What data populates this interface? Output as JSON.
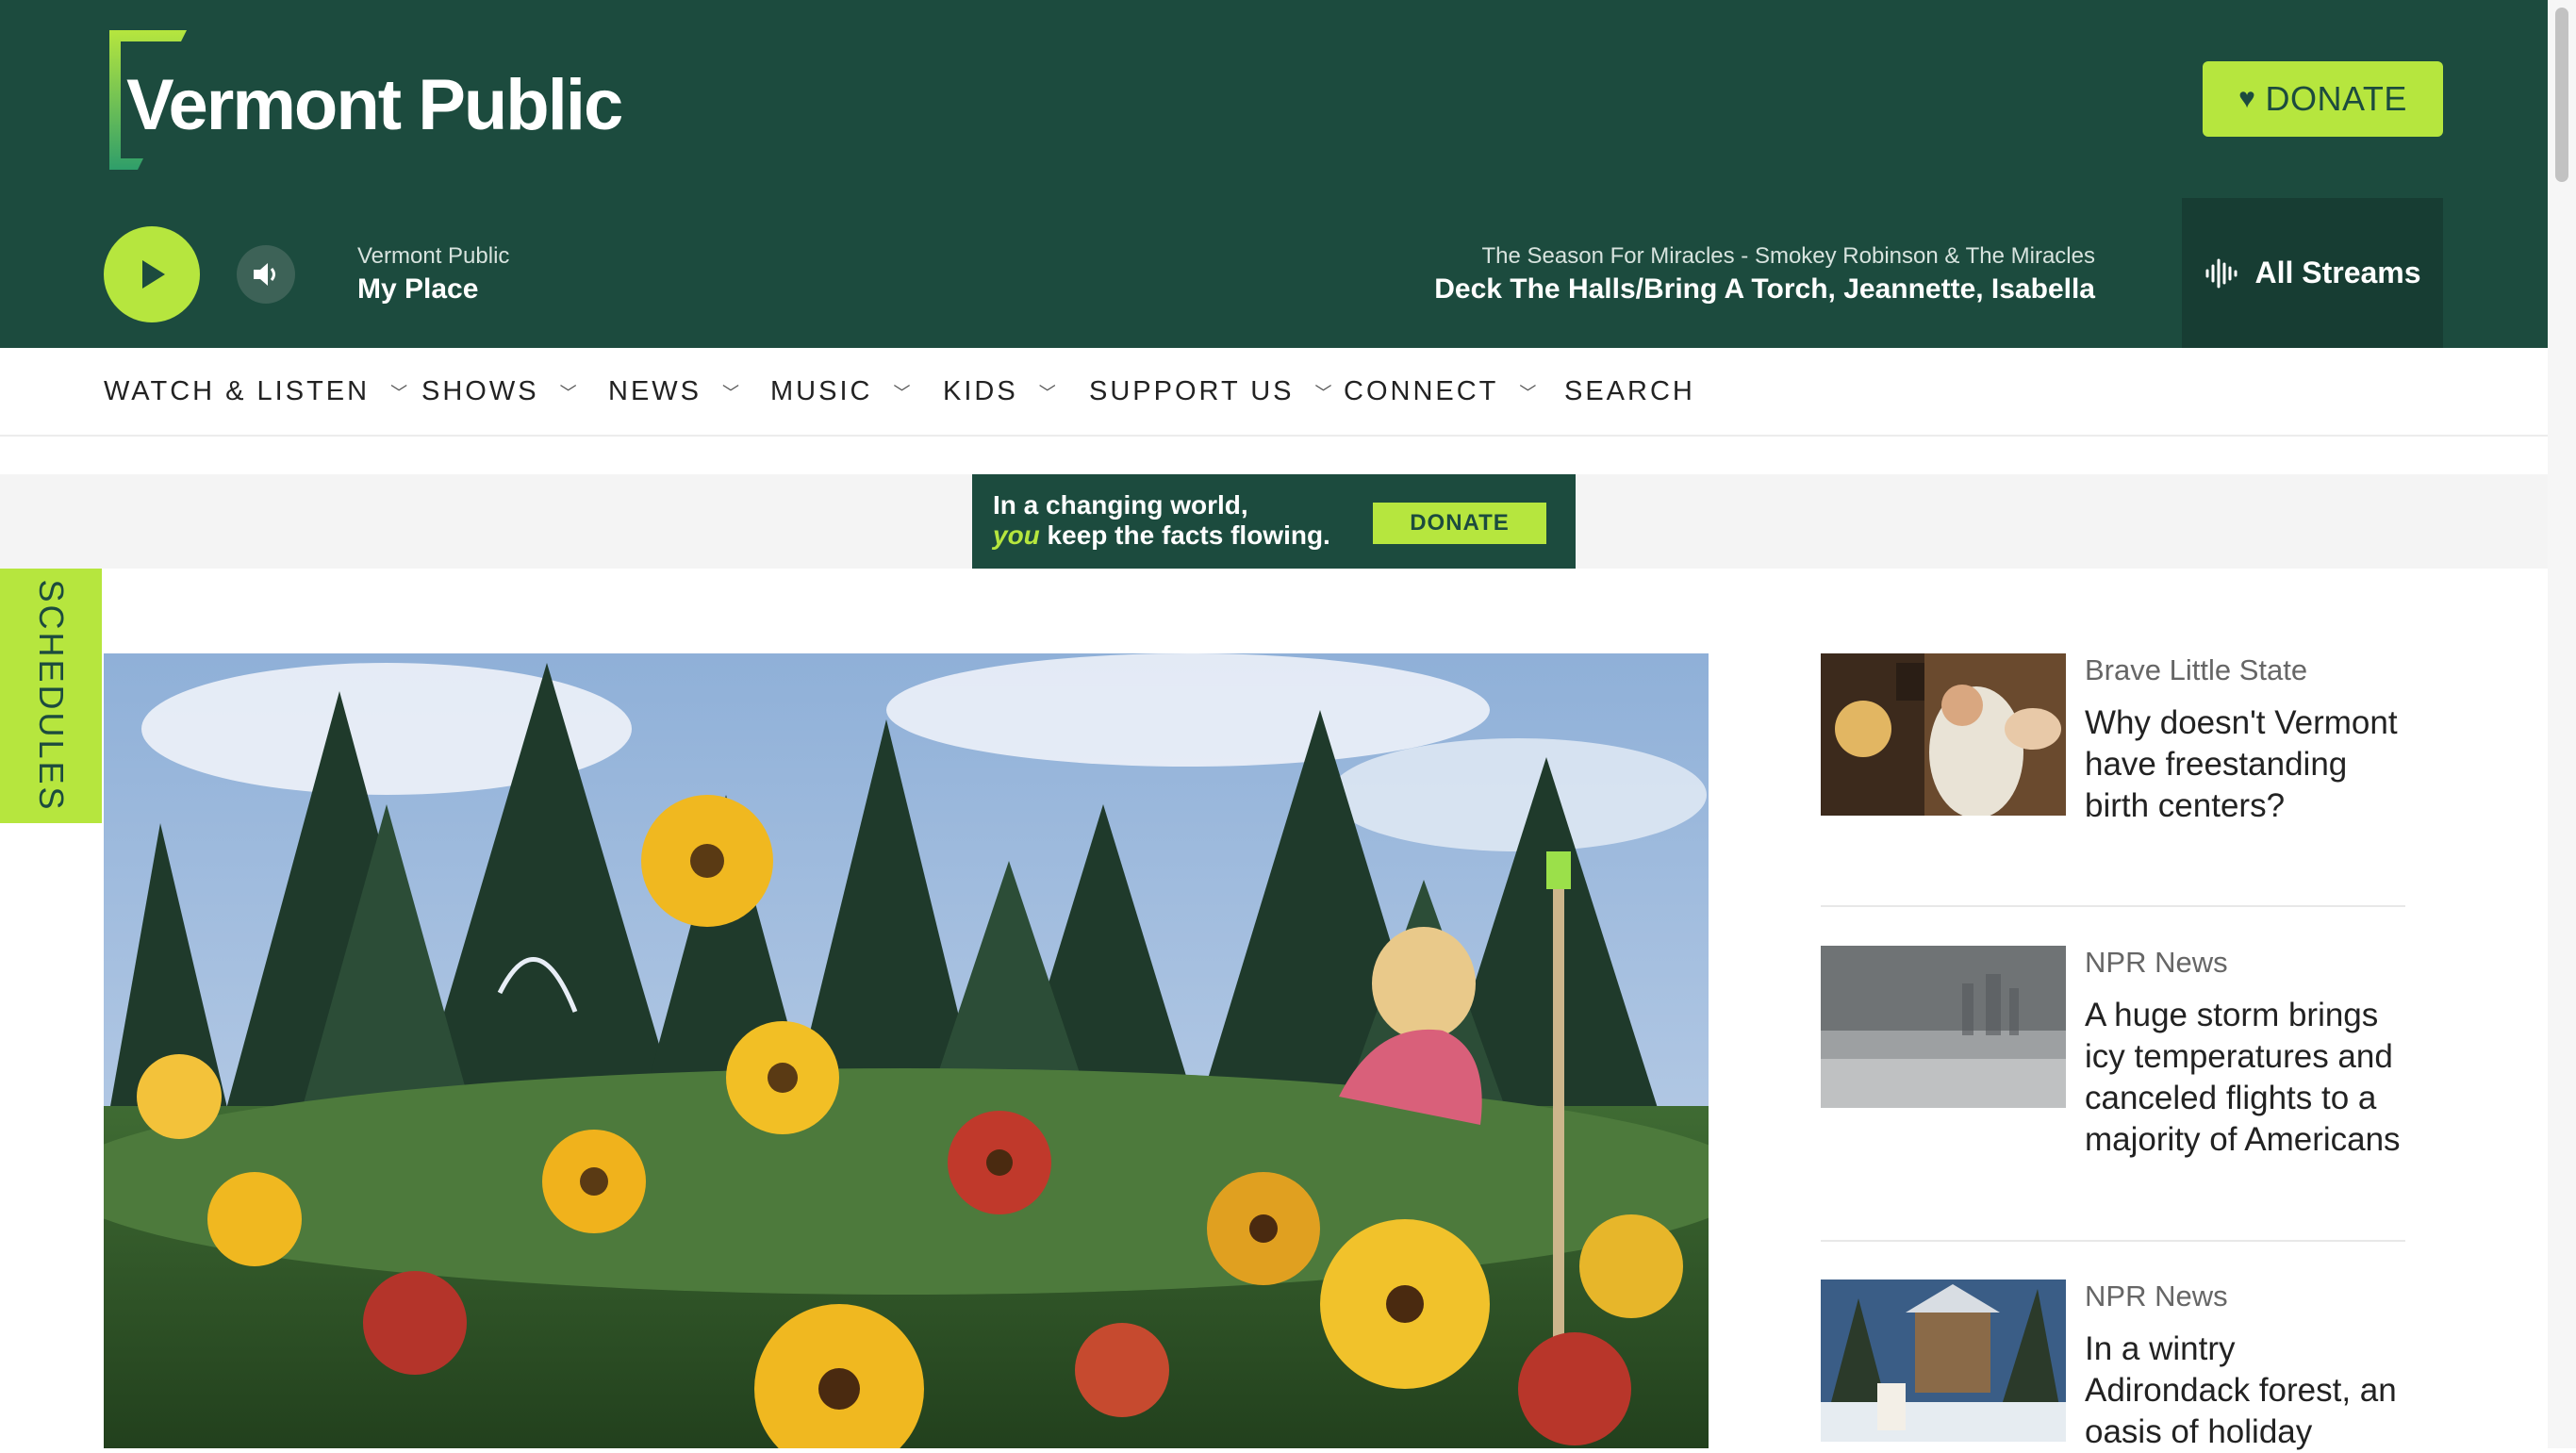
{
  "brand": {
    "name": "Vermont Public"
  },
  "header": {
    "donate_label": "DONATE",
    "player": {
      "station_label": "Vermont Public",
      "program": "My Place",
      "song_info": "The Season For Miracles - Smokey Robinson & The Miracles",
      "song_title": "Deck The Halls/Bring A Torch, Jeannette, Isabella",
      "all_streams_label": "All Streams"
    }
  },
  "nav": {
    "items": [
      {
        "label": "WATCH & LISTEN",
        "has_dropdown": true
      },
      {
        "label": "SHOWS",
        "has_dropdown": true
      },
      {
        "label": "NEWS",
        "has_dropdown": true
      },
      {
        "label": "MUSIC",
        "has_dropdown": true
      },
      {
        "label": "KIDS",
        "has_dropdown": true
      },
      {
        "label": "SUPPORT US",
        "has_dropdown": true
      },
      {
        "label": "CONNECT",
        "has_dropdown": true
      },
      {
        "label": "SEARCH",
        "has_dropdown": false
      }
    ]
  },
  "promo": {
    "line1": "In a changing world,",
    "line2_emph": "you",
    "line2_rest": " keep the facts flowing.",
    "button_label": "DONATE"
  },
  "side_tab": {
    "label": "SCHEDULES"
  },
  "sidebar": {
    "stories": [
      {
        "tag": "Brave Little State",
        "headline": "Why doesn't Vermont have freestanding birth centers?"
      },
      {
        "tag": "NPR News",
        "headline": "A huge storm brings icy temperatures and canceled flights to a majority of Americans"
      },
      {
        "tag": "NPR News",
        "headline": "In a wintry Adirondack forest, an oasis of holiday"
      }
    ]
  },
  "colors": {
    "brand_dark_green": "#1c4b3e",
    "accent_lime": "#b6e63e"
  }
}
